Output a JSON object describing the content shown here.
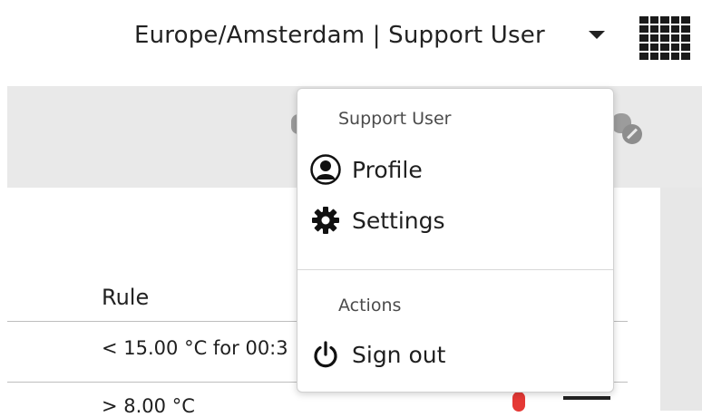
{
  "header": {
    "timezone_user": "Europe/Amsterdam | Support User",
    "dropdown_caret_icon": "caret-down-icon",
    "apps_icon": "app-grid-icon"
  },
  "user_menu": {
    "user_heading": "Support User",
    "items": [
      {
        "label": "Profile",
        "icon": "user-circle-icon"
      },
      {
        "label": "Settings",
        "icon": "gear-icon"
      }
    ],
    "actions_heading": "Actions",
    "action_items": [
      {
        "label": "Sign out",
        "icon": "power-icon"
      }
    ]
  },
  "table": {
    "columns": [
      "Rule"
    ],
    "rows": [
      {
        "rule": "< 15.00 °C for 00:3"
      },
      {
        "rule": "> 8.00 °C"
      }
    ]
  },
  "colors": {
    "accent_status": "#e53935",
    "band": "#e9e9e9"
  }
}
